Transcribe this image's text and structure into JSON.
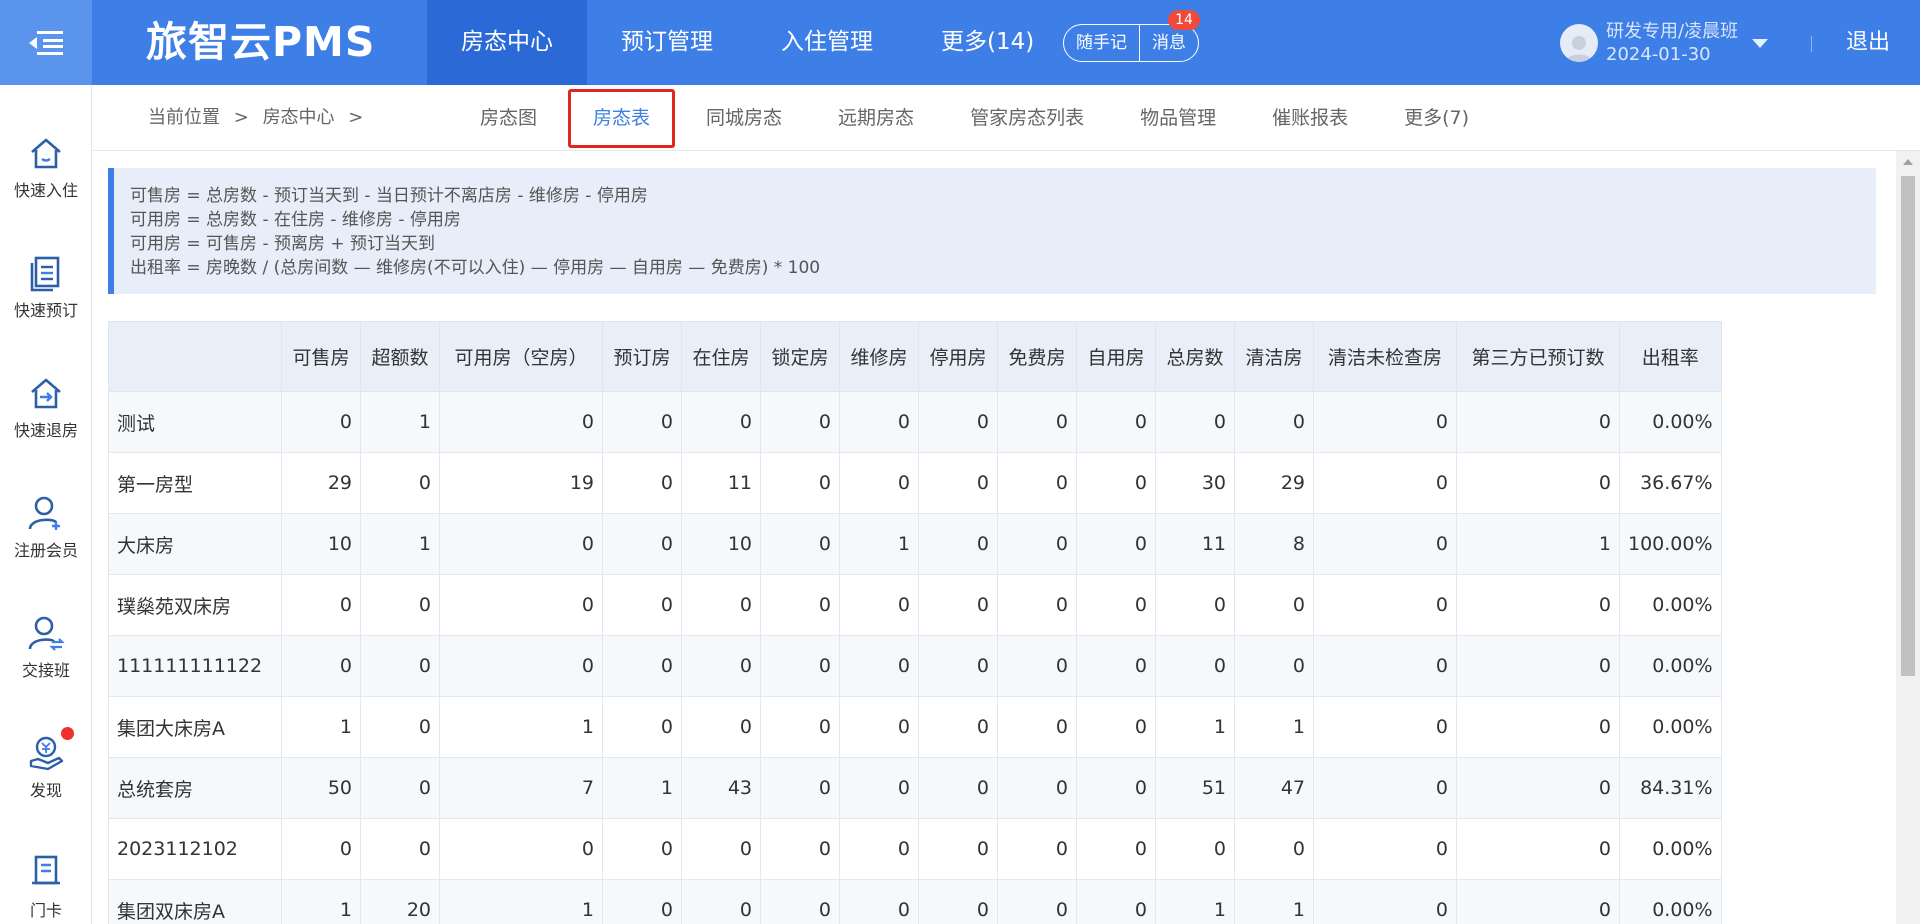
{
  "header": {
    "brand": "旅智云PMS",
    "nav": [
      "房态中心",
      "预订管理",
      "入住管理",
      "更多(14)"
    ],
    "notes_button": "随手记",
    "messages_button": "消息",
    "messages_badge": "14",
    "user_name": "研发专用/凌晨班",
    "user_date": "2024-01-30",
    "logout": "退出"
  },
  "sidebar": {
    "items": [
      {
        "label": "快速入住",
        "icon": "home-icon"
      },
      {
        "label": "快速预订",
        "icon": "document-icon"
      },
      {
        "label": "快速退房",
        "icon": "checkout-icon"
      },
      {
        "label": "注册会员",
        "icon": "user-add-icon"
      },
      {
        "label": "交接班",
        "icon": "user-swap-icon"
      },
      {
        "label": "发现",
        "icon": "discover-icon"
      },
      {
        "label": "门卡",
        "icon": "card-icon"
      }
    ]
  },
  "breadcrumb": {
    "prefix": "当前位置",
    "sep": ">",
    "current": "房态中心"
  },
  "tabs": [
    "房态图",
    "房态表",
    "同城房态",
    "远期房态",
    "管家房态列表",
    "物品管理",
    "催账报表",
    "更多(7)"
  ],
  "active_tab": 1,
  "formulas": [
    "可售房 = 总房数 - 预订当天到 - 当日预计不离店房 - 维修房 - 停用房",
    "可用房 = 总房数 - 在住房 - 维修房 - 停用房",
    "可用房 = 可售房 - 预离房 + 预订当天到",
    "出租率 = 房晚数 / (总房间数 — 维修房(不可以入住) — 停用房 — 自用房 — 免费房) * 100"
  ],
  "table": {
    "columns": [
      "",
      "可售房",
      "超额数",
      "可用房（空房）",
      "预订房",
      "在住房",
      "锁定房",
      "维修房",
      "停用房",
      "免费房",
      "自用房",
      "总房数",
      "清洁房",
      "清洁未检查房",
      "第三方已预订数",
      "出租率"
    ],
    "rows": [
      [
        "测试",
        "0",
        "1",
        "0",
        "0",
        "0",
        "0",
        "0",
        "0",
        "0",
        "0",
        "0",
        "0",
        "0",
        "0",
        "0.00%"
      ],
      [
        "第一房型",
        "29",
        "0",
        "19",
        "0",
        "11",
        "0",
        "0",
        "0",
        "0",
        "0",
        "30",
        "29",
        "0",
        "0",
        "36.67%"
      ],
      [
        "大床房",
        "10",
        "1",
        "0",
        "0",
        "10",
        "0",
        "1",
        "0",
        "0",
        "0",
        "11",
        "8",
        "0",
        "1",
        "100.00%"
      ],
      [
        "璞燊苑双床房",
        "0",
        "0",
        "0",
        "0",
        "0",
        "0",
        "0",
        "0",
        "0",
        "0",
        "0",
        "0",
        "0",
        "0",
        "0.00%"
      ],
      [
        "111111111122",
        "0",
        "0",
        "0",
        "0",
        "0",
        "0",
        "0",
        "0",
        "0",
        "0",
        "0",
        "0",
        "0",
        "0",
        "0.00%"
      ],
      [
        "集团大床房A",
        "1",
        "0",
        "1",
        "0",
        "0",
        "0",
        "0",
        "0",
        "0",
        "0",
        "1",
        "1",
        "0",
        "0",
        "0.00%"
      ],
      [
        "总统套房",
        "50",
        "0",
        "7",
        "1",
        "43",
        "0",
        "0",
        "0",
        "0",
        "0",
        "51",
        "47",
        "0",
        "0",
        "84.31%"
      ],
      [
        "2023112102",
        "0",
        "0",
        "0",
        "0",
        "0",
        "0",
        "0",
        "0",
        "0",
        "0",
        "0",
        "0",
        "0",
        "0",
        "0.00%"
      ],
      [
        "集团双床房A",
        "1",
        "20",
        "1",
        "0",
        "0",
        "0",
        "0",
        "0",
        "0",
        "0",
        "1",
        "1",
        "0",
        "0",
        "0.00%"
      ]
    ]
  },
  "colors": {
    "primary": "#3d7fe6",
    "active_nav": "#2b6ad6",
    "highlight_border": "#e0261f",
    "badge": "#f04b3a"
  }
}
